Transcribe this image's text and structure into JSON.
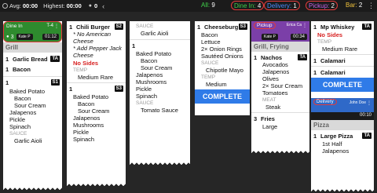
{
  "topbar": {
    "avg_label": "Avg:",
    "avg_value": "00:00",
    "highest_label": "Highest:",
    "highest_value": "00:00",
    "people_count": "0",
    "filters": {
      "all": {
        "label": "All:",
        "count": "9"
      },
      "dinein": {
        "label": "Dine In:",
        "count": "4"
      },
      "delivery": {
        "label": "Delivery:",
        "count": "1"
      },
      "pickup": {
        "label": "Pickup:",
        "count": "2"
      },
      "bar": {
        "label": "Bar:",
        "count": "2"
      }
    },
    "colors": {
      "dinein": "#3fd24a",
      "delivery": "#4a8cff",
      "pickup": "#c463e8",
      "bar": "#f0c23c"
    }
  },
  "col1": {
    "header": {
      "type": "Dine In",
      "table": "T-4",
      "guests": "3",
      "server": "Kate P",
      "timer": "01:12"
    },
    "course": "Grill",
    "items": [
      {
        "qty": "1",
        "name": "Garlic Bread",
        "badge": "TA"
      },
      {
        "qty": "1",
        "name": "Bacon",
        "badge": ""
      }
    ],
    "item3": {
      "qty": "1",
      "badge": "S1"
    },
    "mods3": [
      "Baked Potato",
      "Bacon",
      "Sour Cream",
      "Jalapenos",
      "Pickle",
      "Spinach"
    ],
    "mods3_sauce_label": "SAUCE",
    "mods3_sauce": "Garlic Aioli"
  },
  "col2": {
    "item1": {
      "qty": "1",
      "name": "Chili Burger",
      "badge": "S2"
    },
    "notes": [
      "* No American Cheese",
      "* Add Pepper Jack Cheese"
    ],
    "no_sides": "No Sides",
    "temp_label": "TEMP",
    "temp_value": "Medium Rare",
    "item2": {
      "qty": "1",
      "badge": "S3"
    },
    "mods2": [
      "Baked Potato",
      "Bacon",
      "Sour Cream",
      "Jalapenos",
      "Mushrooms",
      "Pickle",
      "Spinach"
    ]
  },
  "col3": {
    "sauce_label": "SAUCE",
    "sauce_value": "Garlic Aioli",
    "item": {
      "qty": "1",
      "badge": ""
    },
    "mods": [
      "Baked Potato",
      "Bacon",
      "Sour Cream",
      "Jalapenos",
      "Mushrooms",
      "Pickle",
      "Spinach"
    ],
    "sauce2_label": "SAUCE",
    "sauce2_value": "Tomato Sauce"
  },
  "col4": {
    "item": {
      "qty": "1",
      "name": "Cheeseburg",
      "badge": "S3"
    },
    "mods": [
      "Bacon",
      "Lettuce",
      "2× Onion Rings",
      "Sautéed Onions"
    ],
    "sauce_label": "SAUCE",
    "sauce_value": "Chipotle Mayo",
    "temp_label": "TEMP",
    "temp_value": "Medium",
    "complete": "COMPLETE"
  },
  "col5": {
    "header": {
      "type": "Pickup",
      "name": "Erica Ca",
      "server": "Kate P",
      "timer": "00:34"
    },
    "course": "Grill, Frying",
    "item1": {
      "qty": "1",
      "name": "Nachos",
      "badge": "TA"
    },
    "mods1": [
      "Avocados",
      "Jalapenos",
      "Olives",
      "2× Sour Cream",
      "Tomatoes"
    ],
    "meat_label": "MEAT",
    "meat_value": "Steak",
    "item2": {
      "qty": "3",
      "name": "Fries",
      "badge": ""
    },
    "mods2": [
      "Large"
    ]
  },
  "col6": {
    "item1": {
      "qty": "1",
      "name": "Mp Whiskey",
      "badge": "TA"
    },
    "no_sides": "No Sides",
    "temp_label": "TEMP",
    "temp_value": "Medium Rare",
    "item2": {
      "qty": "1",
      "name": "Calamari",
      "badge": ""
    },
    "item3": {
      "qty": "1",
      "name": "Calamari",
      "badge": ""
    },
    "complete": "COMPLETE",
    "header2": {
      "type": "Delivery",
      "name": "John Doe",
      "timer": "00:10"
    },
    "course": "Pizza",
    "item4": {
      "qty": "1",
      "name": "Large Pizza",
      "badge": "TA"
    },
    "mods4": [
      "1st Half",
      "Jalapenos"
    ]
  }
}
